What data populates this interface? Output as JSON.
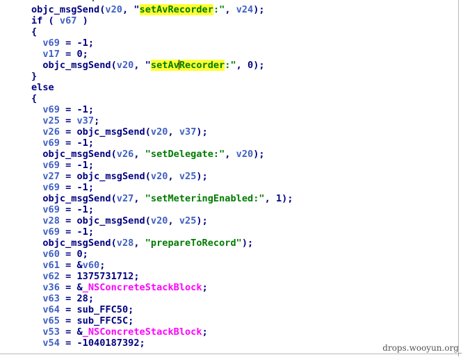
{
  "watermark": "drops.wooyun.org",
  "lines": [
    [
      {
        "t": "objc_msgSend(",
        "c": "kw"
      },
      {
        "t": "v20",
        "c": "var"
      },
      {
        "t": ", \"",
        "c": "kw"
      },
      {
        "t": "setAvRecorder",
        "c": "str",
        "hl": true
      },
      {
        "t": ":\"",
        "c": "str"
      },
      {
        "t": ", ",
        "c": "kw"
      },
      {
        "t": "v24",
        "c": "var"
      },
      {
        "t": ");",
        "c": "kw"
      }
    ],
    [
      {
        "t": "if ( ",
        "c": "kw"
      },
      {
        "t": "v67",
        "c": "var"
      },
      {
        "t": " )",
        "c": "kw"
      }
    ],
    [
      {
        "t": "{",
        "c": "kw"
      }
    ],
    [
      {
        "t": "  ",
        "c": "kw"
      },
      {
        "t": "v69",
        "c": "var"
      },
      {
        "t": " = -1;",
        "c": "kw"
      }
    ],
    [
      {
        "t": "  ",
        "c": "kw"
      },
      {
        "t": "v17",
        "c": "var"
      },
      {
        "t": " = 0;",
        "c": "kw"
      }
    ],
    [
      {
        "t": "  objc_msgSend(",
        "c": "kw"
      },
      {
        "t": "v20",
        "c": "var"
      },
      {
        "t": ", \"",
        "c": "kw"
      },
      {
        "t": "setAv",
        "c": "str",
        "hl": true
      },
      {
        "t": "",
        "c": "cursor"
      },
      {
        "t": "Recorder",
        "c": "str",
        "hl": true
      },
      {
        "t": ":\"",
        "c": "str"
      },
      {
        "t": ", 0);",
        "c": "kw"
      }
    ],
    [
      {
        "t": "}",
        "c": "kw"
      }
    ],
    [
      {
        "t": "else",
        "c": "kw"
      }
    ],
    [
      {
        "t": "{",
        "c": "kw"
      }
    ],
    [
      {
        "t": "  ",
        "c": "kw"
      },
      {
        "t": "v69",
        "c": "var"
      },
      {
        "t": " = -1;",
        "c": "kw"
      }
    ],
    [
      {
        "t": "  ",
        "c": "kw"
      },
      {
        "t": "v25",
        "c": "var"
      },
      {
        "t": " = ",
        "c": "kw"
      },
      {
        "t": "v37",
        "c": "var"
      },
      {
        "t": ";",
        "c": "kw"
      }
    ],
    [
      {
        "t": "  ",
        "c": "kw"
      },
      {
        "t": "v26",
        "c": "var"
      },
      {
        "t": " = objc_msgSend(",
        "c": "kw"
      },
      {
        "t": "v20",
        "c": "var"
      },
      {
        "t": ", ",
        "c": "kw"
      },
      {
        "t": "v37",
        "c": "var"
      },
      {
        "t": ");",
        "c": "kw"
      }
    ],
    [
      {
        "t": "  ",
        "c": "kw"
      },
      {
        "t": "v69",
        "c": "var"
      },
      {
        "t": " = -1;",
        "c": "kw"
      }
    ],
    [
      {
        "t": "  objc_msgSend(",
        "c": "kw"
      },
      {
        "t": "v26",
        "c": "var"
      },
      {
        "t": ", ",
        "c": "kw"
      },
      {
        "t": "\"setDelegate:\"",
        "c": "str"
      },
      {
        "t": ", ",
        "c": "kw"
      },
      {
        "t": "v20",
        "c": "var"
      },
      {
        "t": ");",
        "c": "kw"
      }
    ],
    [
      {
        "t": "  ",
        "c": "kw"
      },
      {
        "t": "v69",
        "c": "var"
      },
      {
        "t": " = -1;",
        "c": "kw"
      }
    ],
    [
      {
        "t": "  ",
        "c": "kw"
      },
      {
        "t": "v27",
        "c": "var"
      },
      {
        "t": " = objc_msgSend(",
        "c": "kw"
      },
      {
        "t": "v20",
        "c": "var"
      },
      {
        "t": ", ",
        "c": "kw"
      },
      {
        "t": "v25",
        "c": "var"
      },
      {
        "t": ");",
        "c": "kw"
      }
    ],
    [
      {
        "t": "  ",
        "c": "kw"
      },
      {
        "t": "v69",
        "c": "var"
      },
      {
        "t": " = -1;",
        "c": "kw"
      }
    ],
    [
      {
        "t": "  objc_msgSend(",
        "c": "kw"
      },
      {
        "t": "v27",
        "c": "var"
      },
      {
        "t": ", ",
        "c": "kw"
      },
      {
        "t": "\"setMeteringEnabled:\"",
        "c": "str"
      },
      {
        "t": ", 1);",
        "c": "kw"
      }
    ],
    [
      {
        "t": "  ",
        "c": "kw"
      },
      {
        "t": "v69",
        "c": "var"
      },
      {
        "t": " = -1;",
        "c": "kw"
      }
    ],
    [
      {
        "t": "  ",
        "c": "kw"
      },
      {
        "t": "v28",
        "c": "var"
      },
      {
        "t": " = objc_msgSend(",
        "c": "kw"
      },
      {
        "t": "v20",
        "c": "var"
      },
      {
        "t": ", ",
        "c": "kw"
      },
      {
        "t": "v25",
        "c": "var"
      },
      {
        "t": ");",
        "c": "kw"
      }
    ],
    [
      {
        "t": "  ",
        "c": "kw"
      },
      {
        "t": "v69",
        "c": "var"
      },
      {
        "t": " = -1;",
        "c": "kw"
      }
    ],
    [
      {
        "t": "  objc_msgSend(",
        "c": "kw"
      },
      {
        "t": "v28",
        "c": "var"
      },
      {
        "t": ", ",
        "c": "kw"
      },
      {
        "t": "\"prepareToRecord\"",
        "c": "str"
      },
      {
        "t": ");",
        "c": "kw"
      }
    ],
    [
      {
        "t": "  ",
        "c": "kw"
      },
      {
        "t": "v60",
        "c": "var"
      },
      {
        "t": " = 0;",
        "c": "kw"
      }
    ],
    [
      {
        "t": "  ",
        "c": "kw"
      },
      {
        "t": "v61",
        "c": "var"
      },
      {
        "t": " = &",
        "c": "kw"
      },
      {
        "t": "v60",
        "c": "var"
      },
      {
        "t": ";",
        "c": "kw"
      }
    ],
    [
      {
        "t": "  ",
        "c": "kw"
      },
      {
        "t": "v62",
        "c": "var"
      },
      {
        "t": " = 1375731712;",
        "c": "kw"
      }
    ],
    [
      {
        "t": "  ",
        "c": "kw"
      },
      {
        "t": "v36",
        "c": "var"
      },
      {
        "t": " = &",
        "c": "kw"
      },
      {
        "t": "_NSConcreteStackBlock",
        "c": "sym"
      },
      {
        "t": ";",
        "c": "kw"
      }
    ],
    [
      {
        "t": "  ",
        "c": "kw"
      },
      {
        "t": "v63",
        "c": "var"
      },
      {
        "t": " = 28;",
        "c": "kw"
      }
    ],
    [
      {
        "t": "  ",
        "c": "kw"
      },
      {
        "t": "v64",
        "c": "var"
      },
      {
        "t": " = sub_FFC50;",
        "c": "kw"
      }
    ],
    [
      {
        "t": "  ",
        "c": "kw"
      },
      {
        "t": "v65",
        "c": "var"
      },
      {
        "t": " = sub_FFC5C;",
        "c": "kw"
      }
    ],
    [
      {
        "t": "  ",
        "c": "kw"
      },
      {
        "t": "v53",
        "c": "var"
      },
      {
        "t": " = &",
        "c": "kw"
      },
      {
        "t": "_NSConcreteStackBlock",
        "c": "sym"
      },
      {
        "t": ";",
        "c": "kw"
      }
    ],
    [
      {
        "t": "  ",
        "c": "kw"
      },
      {
        "t": "v54",
        "c": "var"
      },
      {
        "t": " = -1040187392;",
        "c": "kw"
      }
    ]
  ]
}
